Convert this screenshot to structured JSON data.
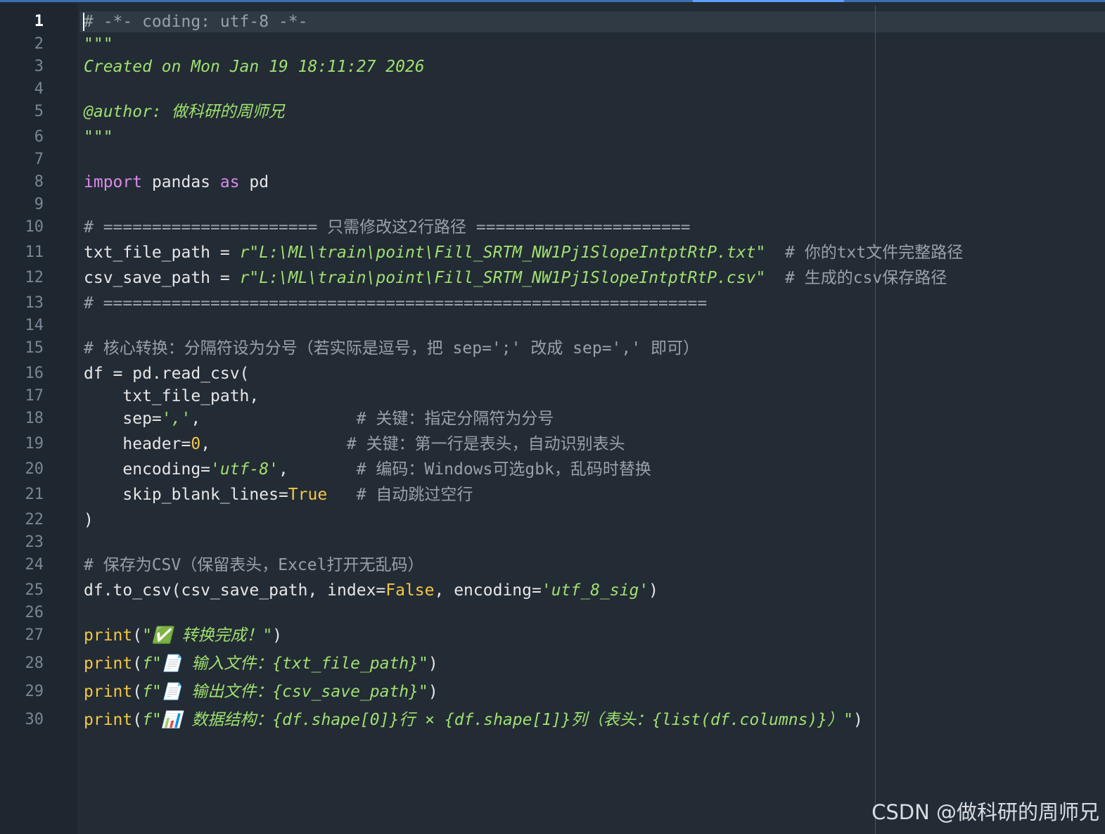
{
  "editor": {
    "active_line": 1,
    "lines": [
      {
        "n": "1",
        "segs": [
          {
            "t": "# -*- coding: utf-8 -*-",
            "c": "cmt"
          }
        ]
      },
      {
        "n": "2",
        "segs": [
          {
            "t": "\"\"\"",
            "c": "doc"
          }
        ]
      },
      {
        "n": "3",
        "segs": [
          {
            "t": "Created on Mon Jan 19 18:11:27 2026",
            "c": "doc"
          }
        ]
      },
      {
        "n": "4",
        "segs": []
      },
      {
        "n": "5",
        "segs": [
          {
            "t": "@author: 做科研的周师兄",
            "c": "doc"
          }
        ]
      },
      {
        "n": "6",
        "segs": [
          {
            "t": "\"\"\"",
            "c": "doc"
          }
        ]
      },
      {
        "n": "7",
        "segs": []
      },
      {
        "n": "8",
        "segs": [
          {
            "t": "import",
            "c": "kw"
          },
          {
            "t": " pandas ",
            "c": ""
          },
          {
            "t": "as",
            "c": "kw"
          },
          {
            "t": " pd",
            "c": ""
          }
        ]
      },
      {
        "n": "9",
        "segs": []
      },
      {
        "n": "10",
        "segs": [
          {
            "t": "# ====================== 只需修改这2行路径 ======================",
            "c": "cmt"
          }
        ]
      },
      {
        "n": "11",
        "segs": [
          {
            "t": "txt_file_path = ",
            "c": ""
          },
          {
            "t": "r\"L:\\ML\\train\\point\\Fill_SRTM_NW1Pj1SlopeIntptRtP.txt\"",
            "c": "str"
          },
          {
            "t": "  # 你的txt文件完整路径",
            "c": "cmt"
          }
        ]
      },
      {
        "n": "12",
        "segs": [
          {
            "t": "csv_save_path = ",
            "c": ""
          },
          {
            "t": "r\"L:\\ML\\train\\point\\Fill_SRTM_NW1Pj1SlopeIntptRtP.csv\"",
            "c": "str"
          },
          {
            "t": "  # 生成的csv保存路径",
            "c": "cmt"
          }
        ]
      },
      {
        "n": "13",
        "segs": [
          {
            "t": "# ==============================================================",
            "c": "cmt"
          }
        ]
      },
      {
        "n": "14",
        "segs": []
      },
      {
        "n": "15",
        "segs": [
          {
            "t": "# 核心转换：分隔符设为分号（若实际是逗号，把 sep=';' 改成 sep=',' 即可）",
            "c": "cmt"
          }
        ]
      },
      {
        "n": "16",
        "segs": [
          {
            "t": "df = pd.read_csv(",
            "c": ""
          }
        ]
      },
      {
        "n": "17",
        "segs": [
          {
            "t": "    txt_file_path,",
            "c": ""
          }
        ]
      },
      {
        "n": "18",
        "segs": [
          {
            "t": "    sep=",
            "c": ""
          },
          {
            "t": "','",
            "c": "str"
          },
          {
            "t": ",                ",
            "c": ""
          },
          {
            "t": "# 关键：指定分隔符为分号",
            "c": "cmt"
          }
        ]
      },
      {
        "n": "19",
        "segs": [
          {
            "t": "    header=",
            "c": ""
          },
          {
            "t": "0",
            "c": "num"
          },
          {
            "t": ",              ",
            "c": ""
          },
          {
            "t": "# 关键：第一行是表头，自动识别表头",
            "c": "cmt"
          }
        ]
      },
      {
        "n": "20",
        "segs": [
          {
            "t": "    encoding=",
            "c": ""
          },
          {
            "t": "'utf-8'",
            "c": "str"
          },
          {
            "t": ",       ",
            "c": ""
          },
          {
            "t": "# 编码：Windows可选gbk，乱码时替换",
            "c": "cmt"
          }
        ]
      },
      {
        "n": "21",
        "segs": [
          {
            "t": "    skip_blank_lines=",
            "c": ""
          },
          {
            "t": "True",
            "c": "num"
          },
          {
            "t": "   ",
            "c": ""
          },
          {
            "t": "# 自动跳过空行",
            "c": "cmt"
          }
        ]
      },
      {
        "n": "22",
        "segs": [
          {
            "t": ")",
            "c": ""
          }
        ]
      },
      {
        "n": "23",
        "segs": []
      },
      {
        "n": "24",
        "segs": [
          {
            "t": "# 保存为CSV（保留表头，Excel打开无乱码）",
            "c": "cmt"
          }
        ]
      },
      {
        "n": "25",
        "segs": [
          {
            "t": "df.to_csv(csv_save_path, index=",
            "c": ""
          },
          {
            "t": "False",
            "c": "num"
          },
          {
            "t": ", encoding=",
            "c": ""
          },
          {
            "t": "'utf_8_sig'",
            "c": "str"
          },
          {
            "t": ")",
            "c": ""
          }
        ]
      },
      {
        "n": "26",
        "segs": []
      },
      {
        "n": "27",
        "segs": [
          {
            "t": "print",
            "c": "fn"
          },
          {
            "t": "(",
            "c": ""
          },
          {
            "t": "\"✅ 转换完成！\"",
            "c": "str"
          },
          {
            "t": ")",
            "c": ""
          }
        ]
      },
      {
        "n": "28",
        "segs": [
          {
            "t": "print",
            "c": "fn"
          },
          {
            "t": "(",
            "c": ""
          },
          {
            "t": "f\"📄 输入文件：{txt_file_path}\"",
            "c": "str"
          },
          {
            "t": ")",
            "c": ""
          }
        ]
      },
      {
        "n": "29",
        "segs": [
          {
            "t": "print",
            "c": "fn"
          },
          {
            "t": "(",
            "c": ""
          },
          {
            "t": "f\"📄 输出文件：{csv_save_path}\"",
            "c": "str"
          },
          {
            "t": ")",
            "c": ""
          }
        ]
      },
      {
        "n": "30",
        "segs": [
          {
            "t": "print",
            "c": "fn"
          },
          {
            "t": "(",
            "c": ""
          },
          {
            "t": "f\"📊 数据结构：{df.shape[0]}行 × {df.shape[1]}列（表头：{list(df.columns)}）\"",
            "c": "str"
          },
          {
            "t": ")",
            "c": ""
          }
        ]
      }
    ]
  },
  "watermark": "CSDN @做科研的周师兄"
}
